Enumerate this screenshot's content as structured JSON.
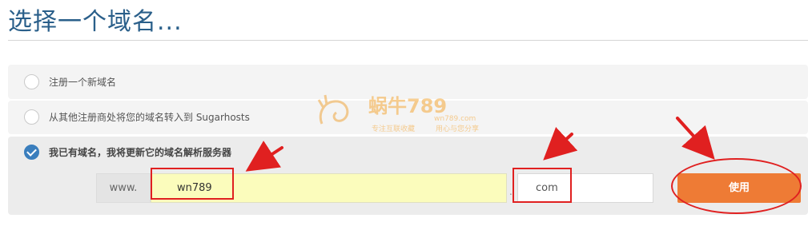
{
  "page": {
    "title": "选择一个域名..."
  },
  "options": [
    {
      "label": "注册一个新域名",
      "selected": false
    },
    {
      "label": "从其他注册商处将您的域名转入到 Sugarhosts",
      "selected": false
    },
    {
      "label": "我已有域名，我将更新它的域名解析服务器",
      "selected": true
    }
  ],
  "domain_form": {
    "prefix": "www.",
    "name_value": "wn789",
    "separator": ".",
    "tld_value": "com",
    "submit_label": "使用"
  },
  "watermark": {
    "brand": "蜗牛789",
    "domain": "wn789.com",
    "slogan_left": "专注互联收藏",
    "slogan_right": "用心与您分享"
  },
  "colors": {
    "title": "#2a5f8a",
    "accent_button": "#ee7b35",
    "checked_radio": "#3a7ebd",
    "annotation": "#e02020",
    "input_highlight": "#fbfcbc"
  }
}
